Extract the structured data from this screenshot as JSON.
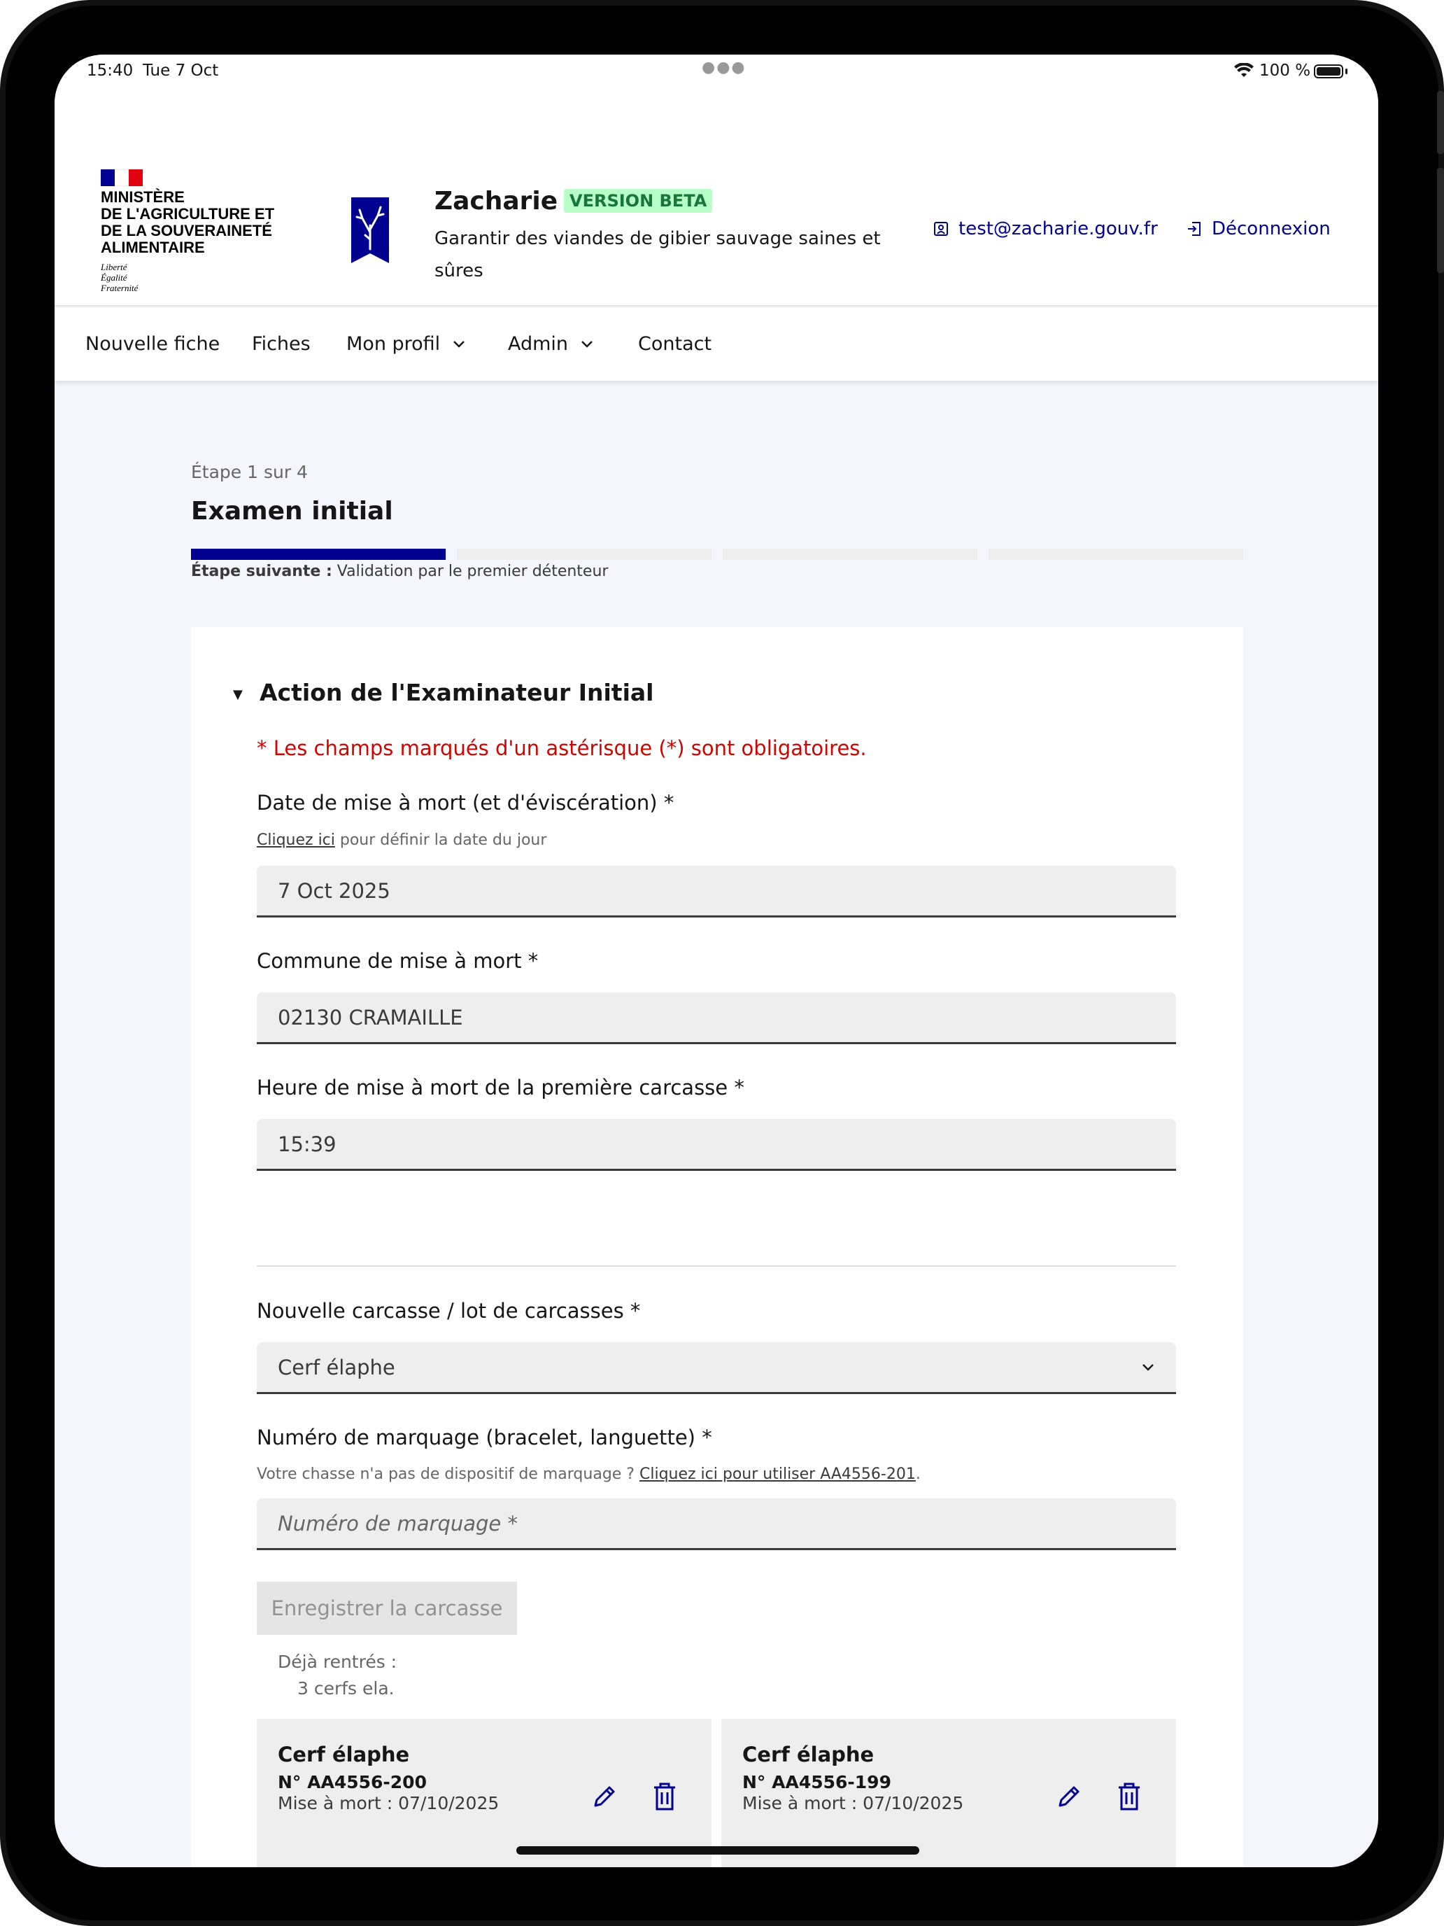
{
  "status_bar": {
    "time": "15:40",
    "date": "Tue 7 Oct",
    "battery": "100 %"
  },
  "header": {
    "ministry_lines": [
      "Ministère",
      "de l'agriculture et",
      "de la souveraineté",
      "alimentaire"
    ],
    "motto_lines": [
      "Liberté",
      "Égalité",
      "Fraternité"
    ],
    "app_name": "Zacharie",
    "badge": "VERSION BETA",
    "tagline": "Garantir des viandes de gibier sauvage saines et sûres",
    "user_email": "test@zacharie.gouv.fr",
    "logout": "Déconnexion"
  },
  "nav": {
    "items": [
      {
        "label": "Nouvelle fiche"
      },
      {
        "label": "Fiches"
      },
      {
        "label": "Mon profil"
      },
      {
        "label": "Admin"
      },
      {
        "label": "Contact"
      }
    ]
  },
  "stepper": {
    "label": "Étape 1 sur 4",
    "title": "Examen initial",
    "total_steps": 4,
    "current_step": 1,
    "next_prefix": "Étape suivante :",
    "next_value": "Validation par le premier détenteur"
  },
  "section": {
    "title": "Action de l'Examinateur Initial",
    "required_note": "* Les champs marqués d'un astérisque (*) sont obligatoires."
  },
  "form": {
    "date": {
      "label": "Date de mise à mort (et d'éviscération) *",
      "hint_link": "Cliquez ici",
      "hint_rest": " pour définir la date du jour",
      "value": "7 Oct 2025"
    },
    "commune": {
      "label": "Commune de mise à mort *",
      "value": "02130 CRAMAILLE"
    },
    "heure": {
      "label": "Heure de mise à mort de la première carcasse *",
      "value": "15:39"
    },
    "espece": {
      "label": "Nouvelle carcasse / lot de carcasses *",
      "value": "Cerf élaphe"
    },
    "marquage": {
      "label": "Numéro de marquage (bracelet, languette) *",
      "hint_prefix": "Votre chasse n'a pas de dispositif de marquage ? ",
      "hint_link": "Cliquez ici pour utiliser AA4556-201",
      "hint_suffix": ".",
      "placeholder": "Numéro de marquage *"
    },
    "save_button": "Enregistrer la carcasse",
    "already_label": "Déjà rentrés :",
    "already_value": "3 cerfs ela."
  },
  "carcasses": [
    {
      "name": "Cerf élaphe",
      "number": "N° AA4556-200",
      "date": "Mise à mort : 07/10/2025"
    },
    {
      "name": "Cerf élaphe",
      "number": "N° AA4556-199",
      "date": "Mise à mort : 07/10/2025"
    }
  ],
  "colors": {
    "primary": "#000091",
    "error": "#ce0500",
    "beta_bg": "#b8fec9",
    "beta_text": "#18753c"
  }
}
